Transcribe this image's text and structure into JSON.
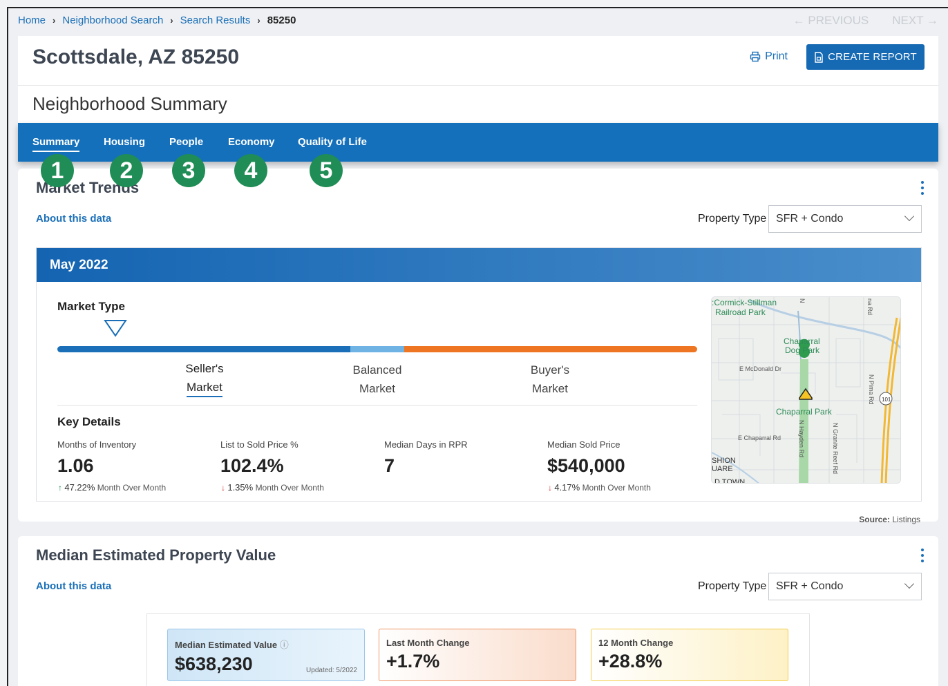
{
  "breadcrumb": [
    {
      "label": "Home"
    },
    {
      "label": "Neighborhood Search"
    },
    {
      "label": "Search Results"
    },
    {
      "label": "85250"
    }
  ],
  "pager": {
    "previous": "← PREVIOUS",
    "next": "NEXT →"
  },
  "header": {
    "title": "Scottsdale, AZ 85250",
    "print_label": "Print",
    "create_report_label": "CREATE REPORT",
    "subtitle": "Neighborhood Summary"
  },
  "tabs": [
    {
      "label": "Summary",
      "badge": "1"
    },
    {
      "label": "Housing",
      "badge": "2"
    },
    {
      "label": "People",
      "badge": "3"
    },
    {
      "label": "Economy",
      "badge": "4"
    },
    {
      "label": "Quality of Life",
      "badge": "5"
    }
  ],
  "market_trends": {
    "title": "Market Trends",
    "about": "About this data",
    "property_type_label": "Property Type",
    "property_type_value": "SFR + Condo",
    "period": "May 2022",
    "market_type_label": "Market Type",
    "markets": [
      {
        "line1": "Seller's",
        "line2": "Market"
      },
      {
        "line1": "Balanced",
        "line2": "Market"
      },
      {
        "line1": "Buyer's",
        "line2": "Market"
      }
    ],
    "key_details_label": "Key Details",
    "details": [
      {
        "label": "Months of Inventory",
        "value": "1.06",
        "change": "47.22%",
        "change_suffix": "Month Over Month",
        "direction": "up"
      },
      {
        "label": "List to Sold Price %",
        "value": "102.4%",
        "change": "1.35%",
        "change_suffix": "Month Over Month",
        "direction": "down"
      },
      {
        "label": "Median Days in RPR",
        "value": "7",
        "change": "",
        "change_suffix": "",
        "direction": ""
      },
      {
        "label": "Median Sold Price",
        "value": "$540,000",
        "change": "4.17%",
        "change_suffix": "Month Over Month",
        "direction": "down"
      }
    ],
    "source_label": "Source:",
    "source_value": "Listings",
    "map": {
      "labels": {
        "park1": ":Cormick-Stillman",
        "park1b": "Railroad Park",
        "dogpark1": "Chaparral",
        "dogpark2": "Dog Park",
        "mcdonald": "E McDonald Dr",
        "chaparral_park": "Chaparral Park",
        "chaparral_rd": "E Chaparral Rd",
        "pima": "N Pima Rd",
        "hayden": "N Hayden Rd",
        "granite": "N Granite Reef Rd",
        "route": "101",
        "shion": "SHION",
        "uare": "UARE",
        "town": "D TOWN",
        "n_top": "N",
        "na_rd": "na Rd"
      }
    }
  },
  "median_value": {
    "title": "Median Estimated Property Value",
    "about": "About this data",
    "property_type_label": "Property Type",
    "property_type_value": "SFR + Condo",
    "cards": [
      {
        "label": "Median Estimated Value",
        "value": "$638,230",
        "updated": "Updated: 5/2022"
      },
      {
        "label": "Last Month Change",
        "value": "+1.7%"
      },
      {
        "label": "12 Month Change",
        "value": "+28.8%"
      }
    ]
  },
  "colors": {
    "primary": "#1570bb",
    "badge": "#1f8d55",
    "seller": "#1a6fb8",
    "balanced": "#6fb2e4",
    "buyer": "#ee7622"
  }
}
